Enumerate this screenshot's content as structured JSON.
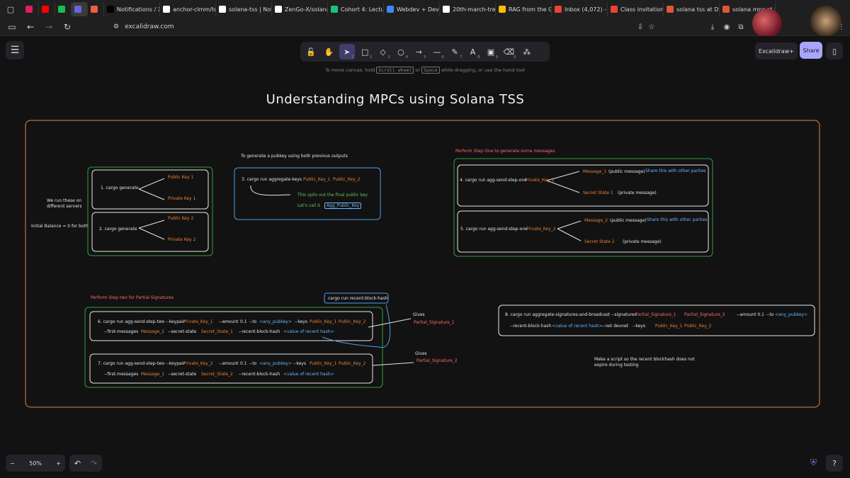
{
  "browser": {
    "tabs": [
      {
        "label": "",
        "color": "#e01e5a"
      },
      {
        "label": "",
        "color": "#ff0000"
      },
      {
        "label": "",
        "color": "#1db954"
      },
      {
        "label": "",
        "color": "#6965db",
        "active": true
      },
      {
        "label": "",
        "color": "#e8633a"
      },
      {
        "label": "Notifications / X",
        "color": "#000000"
      },
      {
        "label": "anchor-clmm/te",
        "color": "#ffffff"
      },
      {
        "label": "solana-tss | Noti",
        "color": "#ffffff"
      },
      {
        "label": "ZenGo-X/solana",
        "color": "#ffffff"
      },
      {
        "label": "Cohort 4: Lectu",
        "color": "#19c37d"
      },
      {
        "label": "Webdev + Devo:",
        "color": "#4285f4"
      },
      {
        "label": "20th-march-tre",
        "color": "#ffffff"
      },
      {
        "label": "RAG from the G",
        "color": "#fbbc04"
      },
      {
        "label": "Inbox (4,072) - I",
        "color": "#ea4335"
      },
      {
        "label": "Class invitation:",
        "color": "#ea4335"
      },
      {
        "label": "solana tss at Du",
        "color": "#de5833"
      },
      {
        "label": "solana mpc at D",
        "color": "#de5833"
      }
    ],
    "url": "excalidraw.com"
  },
  "toolbar": {
    "tools": [
      {
        "icon": "lock-icon",
        "glyph": "🔓",
        "num": ""
      },
      {
        "icon": "hand-icon",
        "glyph": "✋",
        "num": ""
      },
      {
        "icon": "selection-icon",
        "glyph": "➤",
        "num": "1",
        "selected": true
      },
      {
        "icon": "rectangle-icon",
        "glyph": "□",
        "num": "2"
      },
      {
        "icon": "diamond-icon",
        "glyph": "◇",
        "num": "3"
      },
      {
        "icon": "ellipse-icon",
        "glyph": "○",
        "num": "4"
      },
      {
        "icon": "arrow-icon",
        "glyph": "→",
        "num": "5"
      },
      {
        "icon": "line-icon",
        "glyph": "—",
        "num": "6"
      },
      {
        "icon": "pencil-icon",
        "glyph": "✎",
        "num": "7"
      },
      {
        "icon": "text-icon",
        "glyph": "A",
        "num": "8"
      },
      {
        "icon": "image-icon",
        "glyph": "▣",
        "num": "9"
      },
      {
        "icon": "eraser-icon",
        "glyph": "⌫",
        "num": "0"
      },
      {
        "icon": "extra-tools-icon",
        "glyph": "⁂",
        "num": ""
      }
    ],
    "hint_pre": "To move canvas, hold",
    "hint_key1": "Scroll wheel",
    "hint_mid": "or",
    "hint_key2": "Space",
    "hint_post": "while dragging, or use the hand tool",
    "excalidraw_plus": "Excalidraw+",
    "share": "Share"
  },
  "zoom": {
    "value": "50%",
    "minus": "−",
    "plus": "+"
  },
  "colors": {
    "white": "#e6e6e6",
    "orange": "#e8833a",
    "blue": "#6cb7ff",
    "red": "#ff6b6b",
    "green": "#63c463",
    "accent": "#a8a5ff"
  },
  "drawing": {
    "title": "Understanding MPCs using Solana TSS",
    "left_group": {
      "note1": "We run these on",
      "note2": "different servers",
      "note3": "Initial Balance = 0 for both",
      "cmd1": "1. cargo generate",
      "pk1": "Public Key 1",
      "sk1": "Private Key 1",
      "cmd2": "2. cargo generate",
      "pk2": "Public Key 2",
      "sk2": "Private Key 2"
    },
    "agg_group": {
      "heading": "To generate a pubkey using both previous outputs",
      "cmd": "3. cargo run aggregate-keys",
      "k1": "Public_Key_1",
      "k2": "Public_Key_2",
      "note": "This spits out the final public key",
      "call": "Let's call it",
      "agg": "Agg_Public_Key"
    },
    "step_one": {
      "heading": "Perform Step One to generate some messages",
      "cmd4": "4. cargo run agg-send-step-one",
      "k4": "Private_Key_1",
      "msg1": "Message_1",
      "msg1_note": "(public message)",
      "share1": "Share this with other parties",
      "ss1": "Secret State 1",
      "ss1_note": "(private message)",
      "cmd5": "5. cargo run agg-send-step-one",
      "k5": "Private_Key_2",
      "msg2": "Message_2",
      "msg2_note": "(public message)",
      "share2": "Share this with other parties",
      "ss2": "Secret State 2",
      "ss2_note": "(private message)"
    },
    "step_two": {
      "heading": "Perform Step two for Partial Signatures",
      "recent": "cargo run recent-block-hash",
      "c6a": "6. cargo run agg-send-step-two --keypair",
      "c6k": "Private_Key_1",
      "c6b": "--amount",
      "c6amt": "0.1",
      "c6c": "--to",
      "c6to": "<any_pubkey>",
      "c6d": "--keys",
      "c6k1": "Public_Key_1",
      "c6k2": "Public_Key_2",
      "c6e": "--first-messages",
      "c6m": "Message_2",
      "c6f": "--secret-state",
      "c6s": "Secret_State_1",
      "c6g": "--recent-block-hash",
      "c6h": "<value of recent hash>",
      "gives1": "Gives",
      "ps1": "Partial_Signature_1",
      "c7a": "7. cargo run agg-send-step-two --keypair",
      "c7k": "Private_Key_2",
      "c7b": "--amount",
      "c7amt": "0.1",
      "c7c": "--to",
      "c7to": "<any_pubkey>",
      "c7d": "--keys",
      "c7k1": "Public_Key_1",
      "c7k2": "Public_Key_2",
      "c7e": "--first-messages",
      "c7m": "Message_1",
      "c7f": "--secret-state",
      "c7s": "Secret_State_2",
      "c7g": "--recent-block-hash",
      "c7h": "<value of recent hash>",
      "gives2": "Gives",
      "ps2": "Partial_Signature_2"
    },
    "broadcast": {
      "c8a": "8. cargo run aggregate-signatures-and-broadcast --signatures",
      "c8p1": "Partial_Signature_1",
      "c8p2": "Partial_Signature_2",
      "c8b": "--amount 0.1",
      "c8c": "--to",
      "c8to": "<any_pubkey>",
      "c8d": "--recent-block-hash",
      "c8h": "<value of recent hash>",
      "c8e": "--net devnet",
      "c8f": "--keys",
      "c8k1": "Public_Key_1",
      "c8k2": "Public_Key_2",
      "note1": "Make a script so the recent blockhash does not",
      "note2": "expire during testing"
    }
  }
}
